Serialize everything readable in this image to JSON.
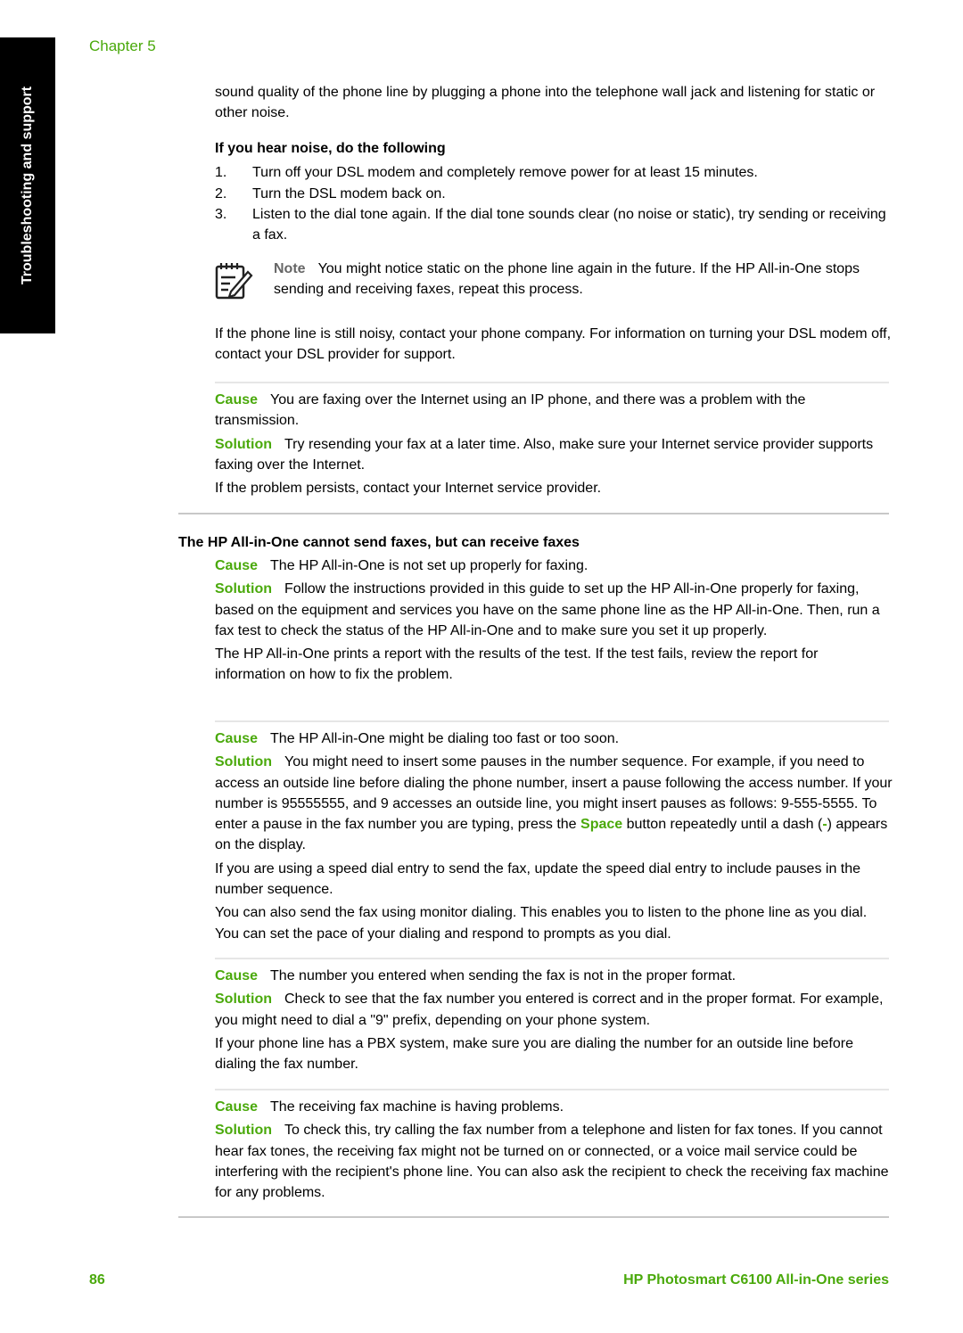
{
  "side_tab": "Troubleshooting and support",
  "chapter": "Chapter 5",
  "intro": {
    "text": "sound quality of the phone line by plugging a phone into the telephone wall jack and listening for static or other noise."
  },
  "noise_steps": {
    "heading": "If you hear noise, do the following",
    "items": [
      {
        "num": "1.",
        "text": "Turn off your DSL modem and completely remove power for at least 15 minutes."
      },
      {
        "num": "2.",
        "text": "Turn the DSL modem back on."
      },
      {
        "num": "3.",
        "text": "Listen to the dial tone again. If the dial tone sounds clear (no noise or static), try sending or receiving a fax."
      }
    ]
  },
  "note": {
    "icon": "note-pad-pencil-icon",
    "label": "Note",
    "text": "You might notice static on the phone line again in the future. If the HP All-in-One stops sending and receiving faxes, repeat this process."
  },
  "still_noisy": "If the phone line is still noisy, contact your phone company. For information on turning your DSL modem off, contact your DSL provider for support.",
  "labels": {
    "cause": "Cause",
    "solution": "Solution"
  },
  "ip_phone": {
    "cause": "You are faxing over the Internet using an IP phone, and there was a problem with the transmission.",
    "solution": "Try resending your fax at a later time. Also, make sure your Internet service provider supports faxing over the Internet.",
    "extra": "If the problem persists, contact your Internet service provider."
  },
  "section2": {
    "heading": "The HP All-in-One cannot send faxes, but can receive faxes",
    "causes": [
      {
        "cause": "The HP All-in-One is not set up properly for faxing.",
        "solution": "Follow the instructions provided in this guide to set up the HP All-in-One properly for faxing, based on the equipment and services you have on the same phone line as the HP All-in-One. Then, run a fax test to check the status of the HP All-in-One and to make sure you set it up properly.",
        "extra": [
          "The HP All-in-One prints a report with the results of the test. If the test fails, review the report for information on how to fix the problem."
        ]
      },
      {
        "cause": "The HP All-in-One might be dialing too fast or too soon.",
        "solution_before": "You might need to insert some pauses in the number sequence. For example, if you need to access an outside line before dialing the phone number, insert a pause following the access number. If your number is 95555555, and 9 accesses an outside line, you might insert pauses as follows: 9-555-5555. To enter a pause in the fax number you are typing, press the ",
        "solution_button": "Space",
        "solution_middle": " button repeatedly until a dash (",
        "solution_dash": "-",
        "solution_after": ") appears on the display.",
        "extra": [
          "If you are using a speed dial entry to send the fax, update the speed dial entry to include pauses in the number sequence.",
          "You can also send the fax using monitor dialing. This enables you to listen to the phone line as you dial. You can set the pace of your dialing and respond to prompts as you dial."
        ]
      },
      {
        "cause": "The number you entered when sending the fax is not in the proper format.",
        "solution": "Check to see that the fax number you entered is correct and in the proper format. For example, you might need to dial a \"9\" prefix, depending on your phone system.",
        "extra": [
          "If your phone line has a PBX system, make sure you are dialing the number for an outside line before dialing the fax number."
        ]
      },
      {
        "cause": "The receiving fax machine is having problems.",
        "solution": "To check this, try calling the fax number from a telephone and listen for fax tones. If you cannot hear fax tones, the receiving fax might not be turned on or connected, or a voice mail service could be interfering with the recipient's phone line. You can also ask the recipient to check the receiving fax machine for any problems."
      }
    ]
  },
  "footer": {
    "page_number": "86",
    "title": "HP Photosmart C6100 All-in-One series"
  },
  "colors": {
    "accent": "#4aa90b",
    "note_label": "#666666"
  }
}
